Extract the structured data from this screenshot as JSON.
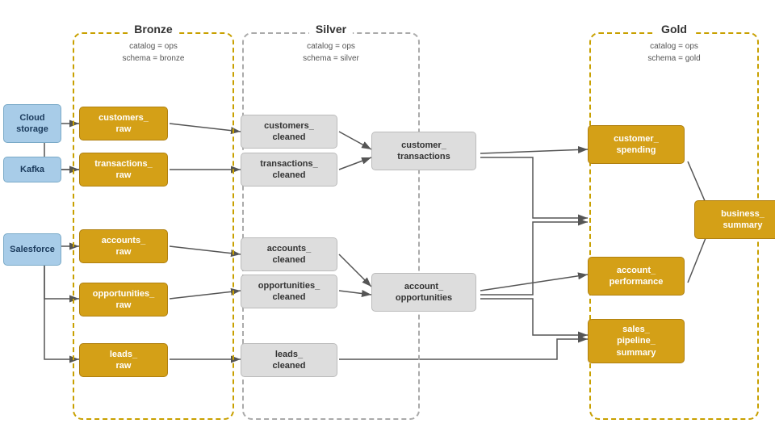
{
  "zones": {
    "bronze": {
      "title": "Bronze",
      "subtitle_line1": "catalog = ops",
      "subtitle_line2": "schema = bronze"
    },
    "silver": {
      "title": "Silver",
      "subtitle_line1": "catalog = ops",
      "subtitle_line2": "schema = silver"
    },
    "gold": {
      "title": "Gold",
      "subtitle_line1": "catalog = ops",
      "subtitle_line2": "schema = gold"
    }
  },
  "sources": [
    {
      "id": "cloud-storage",
      "label": "Cloud\nstorage"
    },
    {
      "id": "kafka",
      "label": "Kafka"
    },
    {
      "id": "salesforce",
      "label": "Salesforce"
    }
  ],
  "bronze_nodes": [
    {
      "id": "customers-raw",
      "label": "customers_\nraw"
    },
    {
      "id": "transactions-raw",
      "label": "transactions_\nraw"
    },
    {
      "id": "accounts-raw",
      "label": "accounts_\nraw"
    },
    {
      "id": "opportunities-raw",
      "label": "opportunities_\nraw"
    },
    {
      "id": "leads-raw",
      "label": "leads_\nraw"
    }
  ],
  "silver_nodes": [
    {
      "id": "customers-cleaned",
      "label": "customers_\ncleaned"
    },
    {
      "id": "transactions-cleaned",
      "label": "transactions_\ncleaned"
    },
    {
      "id": "customer-transactions",
      "label": "customer_\ntransactions"
    },
    {
      "id": "accounts-cleaned",
      "label": "accounts_\ncleaned"
    },
    {
      "id": "opportunities-cleaned",
      "label": "opportunities_\ncleaned"
    },
    {
      "id": "account-opportunities",
      "label": "account_\nopportunities"
    },
    {
      "id": "leads-cleaned",
      "label": "leads_\ncleaned"
    }
  ],
  "gold_nodes": [
    {
      "id": "customer-spending",
      "label": "customer_\nspending"
    },
    {
      "id": "business-summary",
      "label": "business_\nsummary"
    },
    {
      "id": "account-performance",
      "label": "account_\nperformance"
    },
    {
      "id": "sales-pipeline-summary",
      "label": "sales_\npipeline_\nsummary"
    }
  ]
}
